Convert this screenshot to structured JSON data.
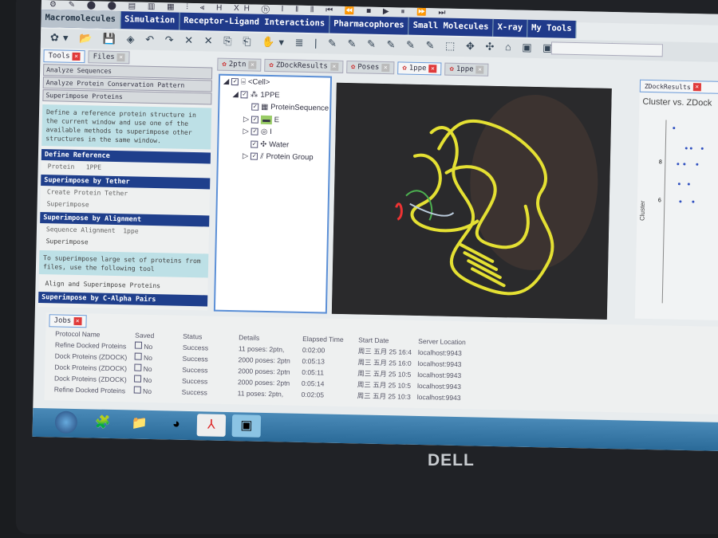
{
  "menu": [
    "Macromolecules",
    "Simulation",
    "Receptor-Ligand Interactions",
    "Pharmacophores",
    "Small Molecules",
    "X-ray",
    "My Tools"
  ],
  "left_tabs": [
    "Tools",
    "Files"
  ],
  "tools": {
    "accordion": [
      "Analyze Sequences",
      "Analyze Protein Conservation Pattern",
      "Superimpose Proteins"
    ],
    "description": "Define a reference protein structure in the current window and use one of the available methods to superimpose other structures in the same window.",
    "define_reference": "Define Reference",
    "protein_label": "Protein",
    "protein_value": "1PPE",
    "tether_header": "Superimpose by Tether",
    "create_tether": "Create Protein Tether",
    "superimpose1": "Superimpose",
    "alignment_header": "Superimpose by Alignment",
    "sequence_alignment": "Sequence Alignment",
    "sequence_alignment_value": "1ppe",
    "superimpose2": "Superimpose",
    "large_set_text": "To superimpose large set of proteins from files, use the following tool",
    "align_tool": "Align and Superimpose Proteins",
    "calpha_header": "Superimpose by C-Alpha Pairs"
  },
  "doc_tabs": [
    {
      "label": "2ptn",
      "active": false
    },
    {
      "label": "ZDockResults",
      "active": false
    },
    {
      "label": "Poses",
      "active": false
    },
    {
      "label": "1ppe",
      "active": true
    },
    {
      "label": "1ppe",
      "active": false
    }
  ],
  "tree": [
    "<Cell>",
    "1PPE",
    "ProteinSequence",
    "E",
    "I",
    "Water",
    "Protein Group"
  ],
  "chart_panel": {
    "tab": "ZDockResults",
    "title": "Cluster vs. ZDock",
    "ylabel": "Cluster",
    "ticks": [
      "8",
      "6"
    ]
  },
  "jobs": {
    "tab": "Jobs",
    "columns": [
      "Protocol Name",
      "Saved",
      "Status",
      "Details",
      "Elapsed Time",
      "Start Date",
      "Server Location"
    ],
    "rows": [
      [
        "Refine Docked Proteins",
        "No",
        "Success",
        "11 poses: 2ptn,",
        "0:02:00",
        "周三 五月 25 16:4",
        "localhost:9943"
      ],
      [
        "Dock Proteins (ZDOCK)",
        "No",
        "Success",
        "2000 poses: 2ptn",
        "0:05:13",
        "周三 五月 25 16:0",
        "localhost:9943"
      ],
      [
        "Dock Proteins (ZDOCK)",
        "No",
        "Success",
        "2000 poses: 2ptn",
        "0:05:11",
        "周三 五月 25 10:5",
        "localhost:9943"
      ],
      [
        "Dock Proteins (ZDOCK)",
        "No",
        "Success",
        "2000 poses: 2ptn",
        "0:05:14",
        "周三 五月 25 10:5",
        "localhost:9943"
      ],
      [
        "Refine Docked Proteins",
        "No",
        "Success",
        "11 poses: 2ptn,",
        "0:02:05",
        "周三 五月 25 10:3",
        "localhost:9943"
      ]
    ]
  },
  "brand": "DELL"
}
